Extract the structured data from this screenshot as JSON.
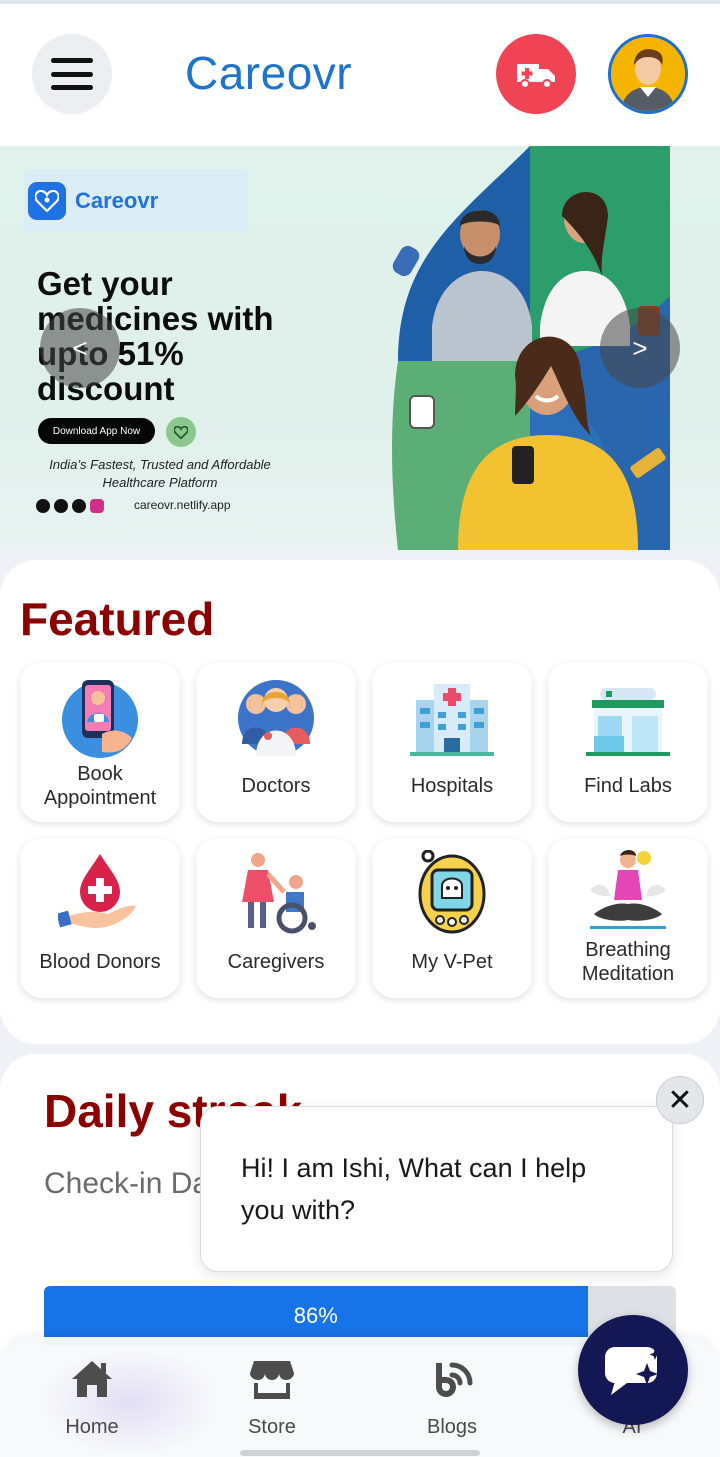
{
  "app": {
    "title": "Careovr",
    "menu_icon": "hamburger-icon",
    "ambulance_icon": "ambulance-icon",
    "avatar_icon": "user-avatar-icon"
  },
  "banner": {
    "logo_text": "Careovr",
    "headline": "Get your medicines with upto 51% discount",
    "download_label": "Download App Now",
    "tagline": "India’s Fastest, Trusted and Affordable Healthcare Platform",
    "url": "careovr.netlify.app",
    "prev_label": "<",
    "next_label": ">"
  },
  "featured": {
    "title": "Featured",
    "items": [
      {
        "label": "Book Appointment",
        "icon": "phone-doctor-icon"
      },
      {
        "label": "Doctors",
        "icon": "doctors-group-icon"
      },
      {
        "label": "Hospitals",
        "icon": "hospital-building-icon"
      },
      {
        "label": "Find Labs",
        "icon": "lab-building-icon"
      },
      {
        "label": "Blood Donors",
        "icon": "blood-drop-hand-icon"
      },
      {
        "label": "Caregivers",
        "icon": "caregiver-wheelchair-icon"
      },
      {
        "label": "My V-Pet",
        "icon": "virtual-pet-icon"
      },
      {
        "label": "Breathing Meditation",
        "icon": "meditation-icon"
      }
    ]
  },
  "streak": {
    "title": "Daily streak",
    "subtitle": "Check-in Daily to Get Assured Rewards",
    "progress_label": "86%",
    "progress_value": 0.86
  },
  "chat": {
    "message": "Hi! I am Ishi, What can I help you with?",
    "close_icon": "close-icon",
    "fab_icon": "chat-bot-icon"
  },
  "nav": {
    "items": [
      {
        "label": "Home",
        "icon": "home-icon"
      },
      {
        "label": "Store",
        "icon": "store-icon"
      },
      {
        "label": "Blogs",
        "icon": "blog-feed-icon"
      },
      {
        "label": "AI",
        "icon": "ai-icon"
      }
    ]
  },
  "colors": {
    "brand_blue": "#1c74cf",
    "section_title": "#8b0000",
    "ambulance_red": "#f04454",
    "progress_blue": "#1773e8",
    "fab_navy": "#131753"
  }
}
